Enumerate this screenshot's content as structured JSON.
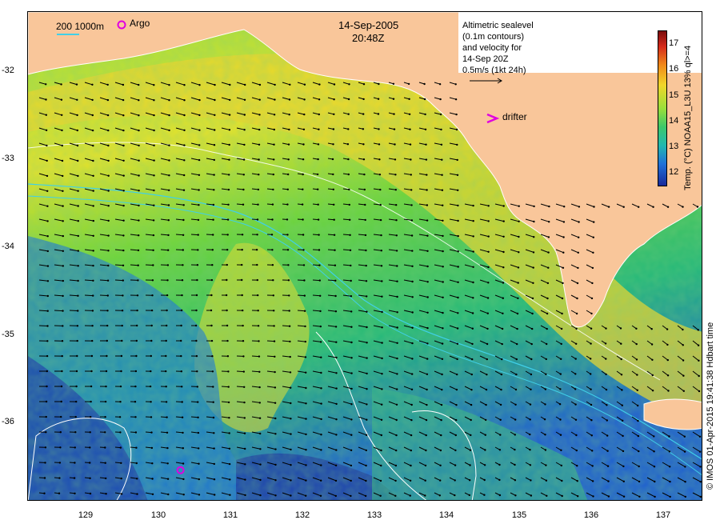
{
  "datetime": {
    "date": "14-Sep-2005",
    "time": "20:48Z"
  },
  "legend": {
    "bathymetry": "200  1000m",
    "argo": "Argo",
    "drifter": "drifter"
  },
  "altimetry_note": [
    "Altimetric sealevel",
    "(0.1m contours)",
    "and velocity for",
    "14-Sep 20Z",
    "0.5m/s (1kt 24h)"
  ],
  "colorbar": {
    "title": "Temp. (°C) NOAA15_L3U 13% ql>=4",
    "ticks": [
      "12",
      "13",
      "14",
      "15",
      "16",
      "17"
    ],
    "range": [
      11.5,
      17.5
    ]
  },
  "credit": "© IMOS 01-Apr-2015 19:41:38 Hdbart time",
  "axes": {
    "x_ticks": [
      "129",
      "130",
      "131",
      "132",
      "133",
      "134",
      "135",
      "136",
      "137"
    ],
    "y_ticks": [
      "-32",
      "-33",
      "-34",
      "-35",
      "-36"
    ],
    "lon_range": [
      128.2,
      137.5
    ],
    "lat_range": [
      -31.45,
      -36.9
    ]
  },
  "colors": {
    "land": "#f9c69a",
    "contour_cyan": "#40d0e8",
    "contour_white": "#ffffff",
    "marker": "#e000e0"
  },
  "markers": {
    "argo_lon": 130.3,
    "argo_lat": -36.55
  }
}
